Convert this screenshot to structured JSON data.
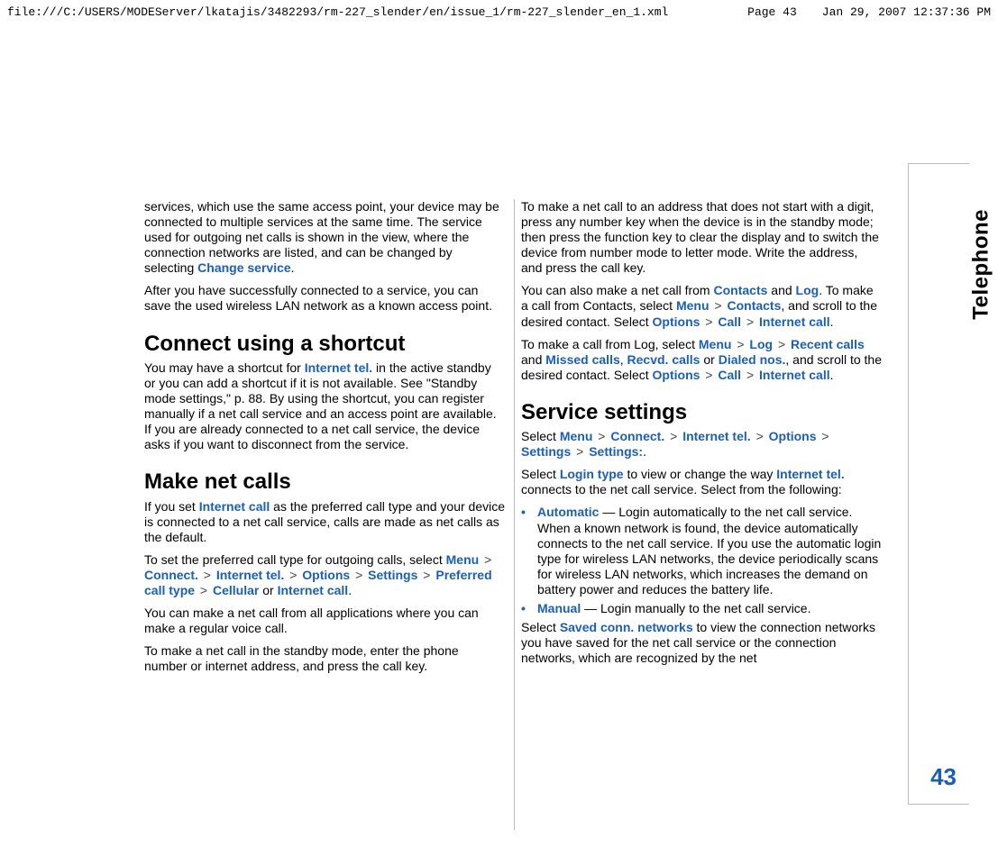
{
  "header": {
    "path": "file:///C:/USERS/MODEServer/lkatajis/3482293/rm-227_slender/en/issue_1/rm-227_slender_en_1.xml",
    "page": "Page 43",
    "timestamp": "Jan 29, 2007 12:37:36 PM"
  },
  "sidebar": {
    "label": "Telephone"
  },
  "page_number": "43",
  "left": {
    "p1_a": "services, which use the same access point, your device may be connected to multiple services at the same time. The service used for outgoing net calls is shown in the view, where the connection networks are listed, and can be changed by selecting ",
    "p1_link": "Change service",
    "p1_b": ".",
    "p2": "After you have successfully connected to a service, you can save the used wireless LAN network as a known access point.",
    "h1": "Connect using a shortcut",
    "p3_a": "You may have a shortcut for ",
    "p3_link": "Internet tel.",
    "p3_b": " in the active standby or you can add a shortcut if it is not available. See \"Standby mode settings,\" p. 88. By using the shortcut, you can register manually if a net call service and an access point are available. If you are already connected to a net call service, the device asks if you want to disconnect from the service.",
    "h2": "Make net calls",
    "p4_a": "If you set ",
    "p4_link": "Internet call",
    "p4_b": " as the preferred call type and your device is connected to a net call service, calls are made as net calls as the default.",
    "p5_a": "To set the preferred call type for outgoing calls, select ",
    "p5_menu": "Menu",
    "p5_connect": "Connect.",
    "p5_internet": "Internet tel.",
    "p5_options": "Options",
    "p5_settings": "Settings",
    "p5_preferred": "Preferred call type",
    "p5_cellular": "Cellular",
    "p5_or": " or ",
    "p5_netcall": "Internet call",
    "p5_end": ".",
    "p6": "You can make a net call from all applications where you can make a regular voice call.",
    "p7": "To make a net call in the standby mode, enter the phone number or internet address, and press the call key."
  },
  "right": {
    "p1": "To make a net call to an address that does not start with a digit, press any number key when the device is in the standby mode; then press the function key to clear the display and to switch the device from number mode to letter mode. Write the address, and press the call key.",
    "p2_a": "You can also make a net call from ",
    "p2_contacts": "Contacts",
    "p2_and": " and ",
    "p2_log": "Log",
    "p2_b": ". To make a call from Contacts, select ",
    "p2_menu": "Menu",
    "p2_contacts2": "Contacts",
    "p2_c": ", and scroll to the desired contact. Select ",
    "p2_options": "Options",
    "p2_call": "Call",
    "p2_internet": "Internet call",
    "p2_end": ".",
    "p3_a": "To make a call from Log, select ",
    "p3_menu": "Menu",
    "p3_log": "Log",
    "p3_recent": "Recent calls",
    "p3_and": " and ",
    "p3_missed": "Missed calls",
    "p3_comma": ", ",
    "p3_recvd": "Recvd. calls",
    "p3_or": " or ",
    "p3_dialed": "Dialed nos.",
    "p3_b": ", and scroll to the desired contact. Select ",
    "p3_options": "Options",
    "p3_call": "Call",
    "p3_internet": "Internet call",
    "p3_end": ".",
    "h1": "Service settings",
    "p4_a": "Select ",
    "p4_menu": "Menu",
    "p4_connect": "Connect.",
    "p4_internet": "Internet tel.",
    "p4_options": "Options",
    "p4_settings": "Settings",
    "p4_settings2": "Settings:",
    "p4_end": ".",
    "p5_a": "Select ",
    "p5_login": "Login type",
    "p5_b": " to view or change the way ",
    "p5_internet": "Internet tel.",
    "p5_c": " connects to the net call service. Select from the following:",
    "b1_label": "Automatic",
    "b1_body": " — Login automatically to the net call service. When a known network is found, the device automatically connects to the net call service. If you use the automatic login type for wireless LAN networks, the device periodically scans for wireless LAN networks, which increases the demand on battery power and reduces the battery life.",
    "b2_label": "Manual",
    "b2_body": " —  Login manually to the net call service.",
    "p6_a": "Select ",
    "p6_saved": "Saved conn. networks",
    "p6_b": " to view the connection networks you have saved for the net call service or the connection networks, which are recognized by the net"
  },
  "sep": ">",
  "bullet": "•"
}
